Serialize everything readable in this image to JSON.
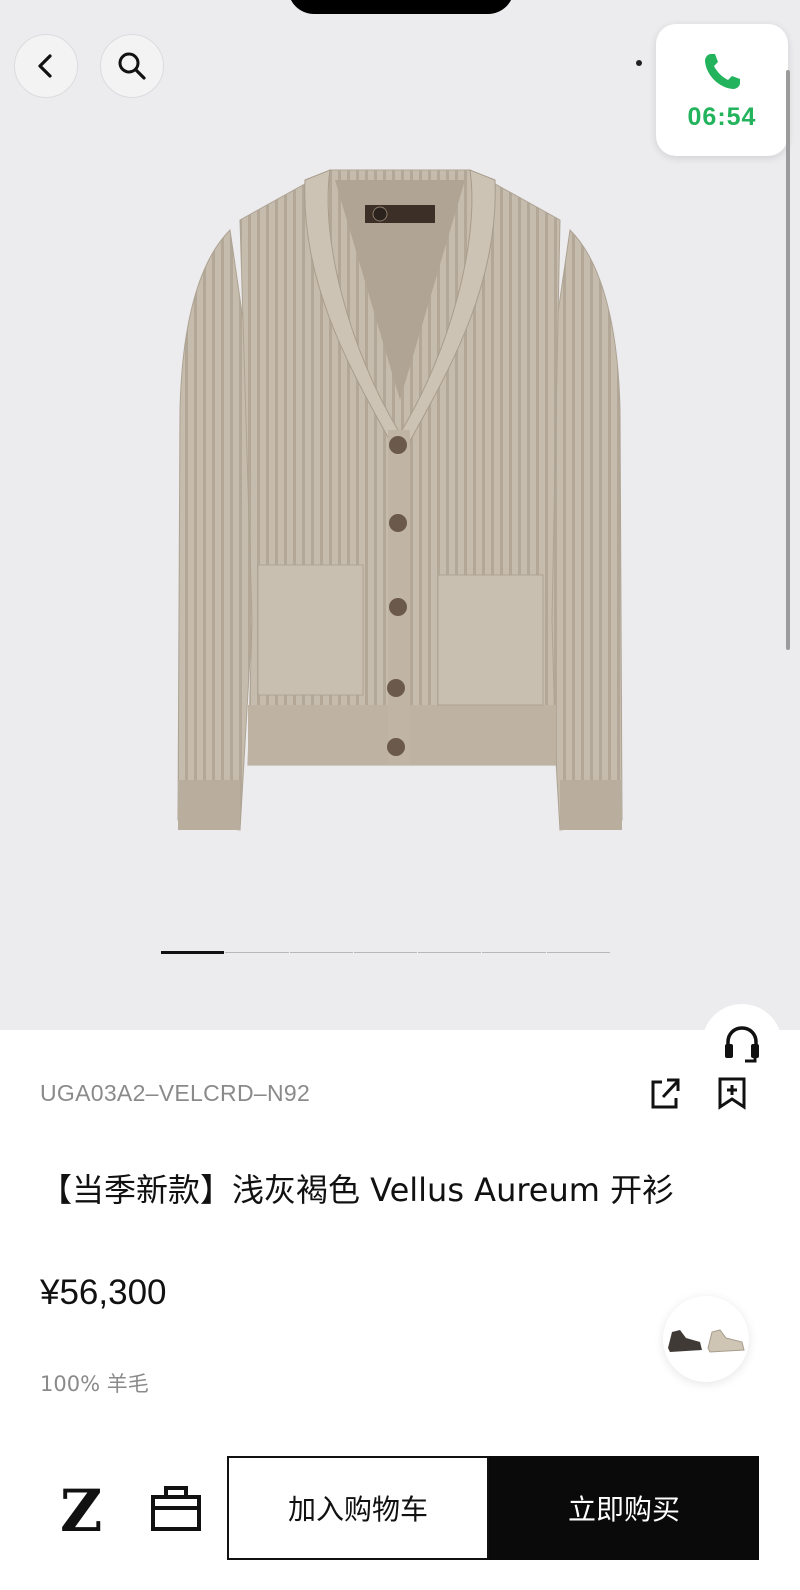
{
  "call": {
    "time": "06:54"
  },
  "product": {
    "sku": "UGA03A2–VELCRD–N92",
    "title": "【当季新款】浅灰褐色 Vellus Aureum 开衫",
    "price": "¥56,300",
    "material": "100% 羊毛",
    "image_icon": "beige-cardigan-image",
    "carousel": {
      "count": 7,
      "active": 1
    }
  },
  "bottom_bar": {
    "logo": "Z",
    "add_to_cart": "加入购物车",
    "buy_now": "立即购买"
  },
  "icons": {
    "back": "chevron-left-icon",
    "search": "search-icon",
    "phone": "phone-icon",
    "headset": "headset-icon",
    "share": "share-icon",
    "bookmark": "bookmark-add-icon",
    "shoes": "shoes-thumbnail-icon",
    "bag": "shopping-bag-icon"
  },
  "colors": {
    "call_green": "#22b35c",
    "hero_bg": "#ececee",
    "cardigan": "#c4b9aa",
    "button_dark": "#0a0a0a"
  }
}
